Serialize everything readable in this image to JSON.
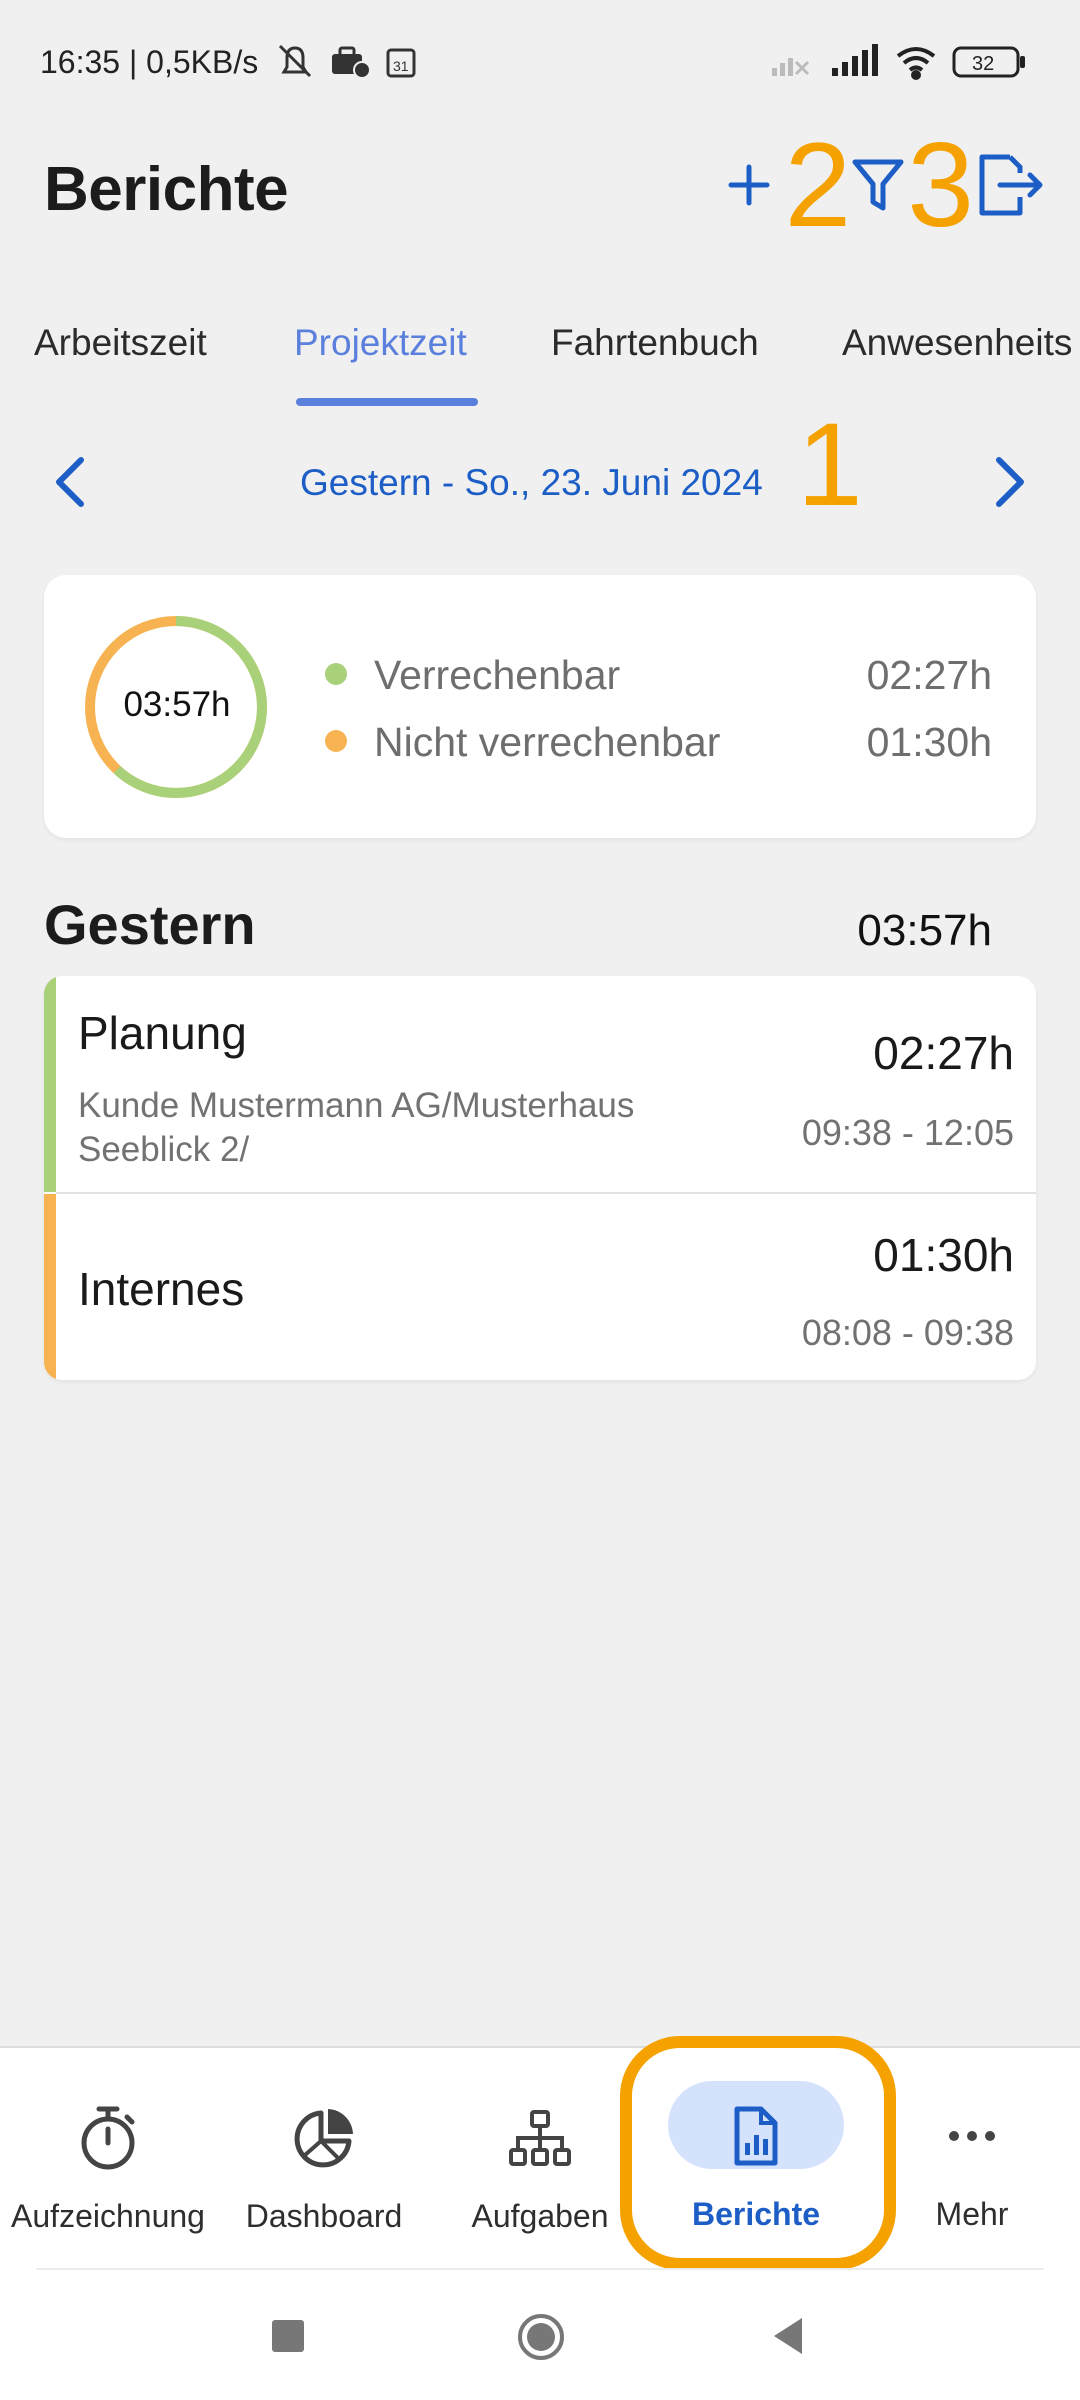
{
  "status_bar": {
    "time": "16:35 | 0,5KB/s",
    "battery": "32"
  },
  "header": {
    "title": "Berichte",
    "add_icon": "plus-icon",
    "annotation_2": "2",
    "filter_icon": "filter-icon",
    "annotation_3": "3",
    "export_icon": "export-icon"
  },
  "tabs": [
    {
      "label": "Arbeitszeit",
      "active": false
    },
    {
      "label": "Projektzeit",
      "active": true
    },
    {
      "label": "Fahrtenbuch",
      "active": false
    },
    {
      "label": "Anwesenheits",
      "active": false
    }
  ],
  "date_nav": {
    "label": "Gestern - So., 23. Juni 2024",
    "annotation_1": "1"
  },
  "summary": {
    "total": "03:57h",
    "billable_fraction": 0.62,
    "legend": [
      {
        "label": "Verrechenbar",
        "value": "02:27h",
        "color": "#a8d17a"
      },
      {
        "label": "Nicht verrechenbar",
        "value": "01:30h",
        "color": "#f7b352"
      }
    ]
  },
  "day": {
    "title": "Gestern",
    "total": "03:57h",
    "entries": [
      {
        "name": "Planung",
        "subtitle": "Kunde Mustermann AG/Musterhaus Seeblick 2/",
        "duration": "02:27h",
        "range": "09:38 - 12:05",
        "color": "#a8d17a"
      },
      {
        "name": "Internes",
        "subtitle": "",
        "duration": "01:30h",
        "range": "08:08 - 09:38",
        "color": "#f7b352"
      }
    ]
  },
  "bottom_nav": [
    {
      "label": "Aufzeichnung",
      "icon": "stopwatch-icon"
    },
    {
      "label": "Dashboard",
      "icon": "pie-chart-icon"
    },
    {
      "label": "Aufgaben",
      "icon": "hierarchy-icon"
    },
    {
      "label": "Berichte",
      "icon": "report-icon",
      "active": true
    },
    {
      "label": "Mehr",
      "icon": "more-icon"
    }
  ],
  "colors": {
    "accent": "#1d5ec6",
    "tab_active": "#5b7fdc",
    "annotation": "#f5a200"
  }
}
